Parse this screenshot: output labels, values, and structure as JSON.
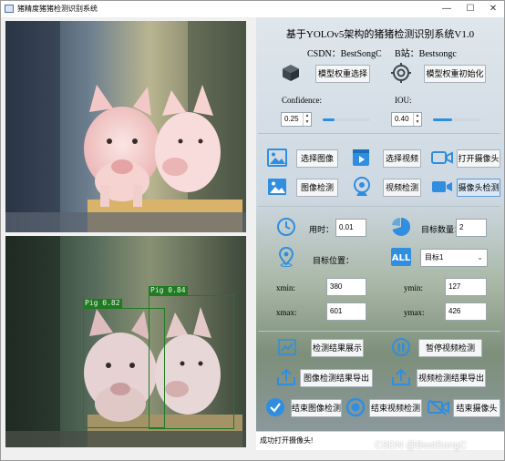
{
  "window": {
    "title": "猪精度猪猪检测识别系统",
    "minimize_glyph": "—",
    "maximize_glyph": "☐",
    "close_glyph": "✕"
  },
  "header": {
    "title": "基于YOLOv5架构的猪猪检测识别系统V1.0",
    "csdn": "CSDN：BestSongC",
    "bilibili": "B站：Bestsongc"
  },
  "model": {
    "select_label": "模型权重选择",
    "init_label": "模型权重初始化",
    "select_icon": "cube-icon",
    "init_icon": "target-gear-icon"
  },
  "thresholds": {
    "confidence_label": "Confidence:",
    "confidence_value": "0.25",
    "iou_label": "IOU:",
    "iou_value": "0.40",
    "confidence_slider": 0.25,
    "iou_slider": 0.4
  },
  "source_buttons": {
    "select_image": "选择图像",
    "select_video": "选择视频",
    "open_camera": "打开摄像头",
    "detect_image": "图像检测",
    "detect_video": "视频检测",
    "detect_camera": "摄像头检测"
  },
  "results": {
    "time_label": "用时：",
    "time_value": "0.01",
    "count_label": "目标数量：",
    "count_value": "2",
    "position_label": "目标位置：",
    "target_select": "目标1",
    "xmin_label": "xmin:",
    "xmin_value": "380",
    "ymin_label": "ymin:",
    "ymin_value": "127",
    "xmax_label": "xmax:",
    "xmax_value": "601",
    "ymax_label": "ymax:",
    "ymax_value": "426"
  },
  "actions": {
    "show_results": "检测结果展示",
    "pause_video": "暂停视频检测",
    "export_image": "图像检测结果导出",
    "export_video": "视频检测结果导出",
    "end_image": "结束图像检测",
    "end_video": "结束视频检测",
    "end_camera": "结束摄像头"
  },
  "detections": [
    {
      "label": "Pig 0.82"
    },
    {
      "label": "Pig 0.84"
    }
  ],
  "status": "成功打开摄像头!",
  "watermark": "CSDN @BestSongC",
  "colors": {
    "accent_blue": "#2f8ee0",
    "bbox_green": "#1f7a22"
  }
}
